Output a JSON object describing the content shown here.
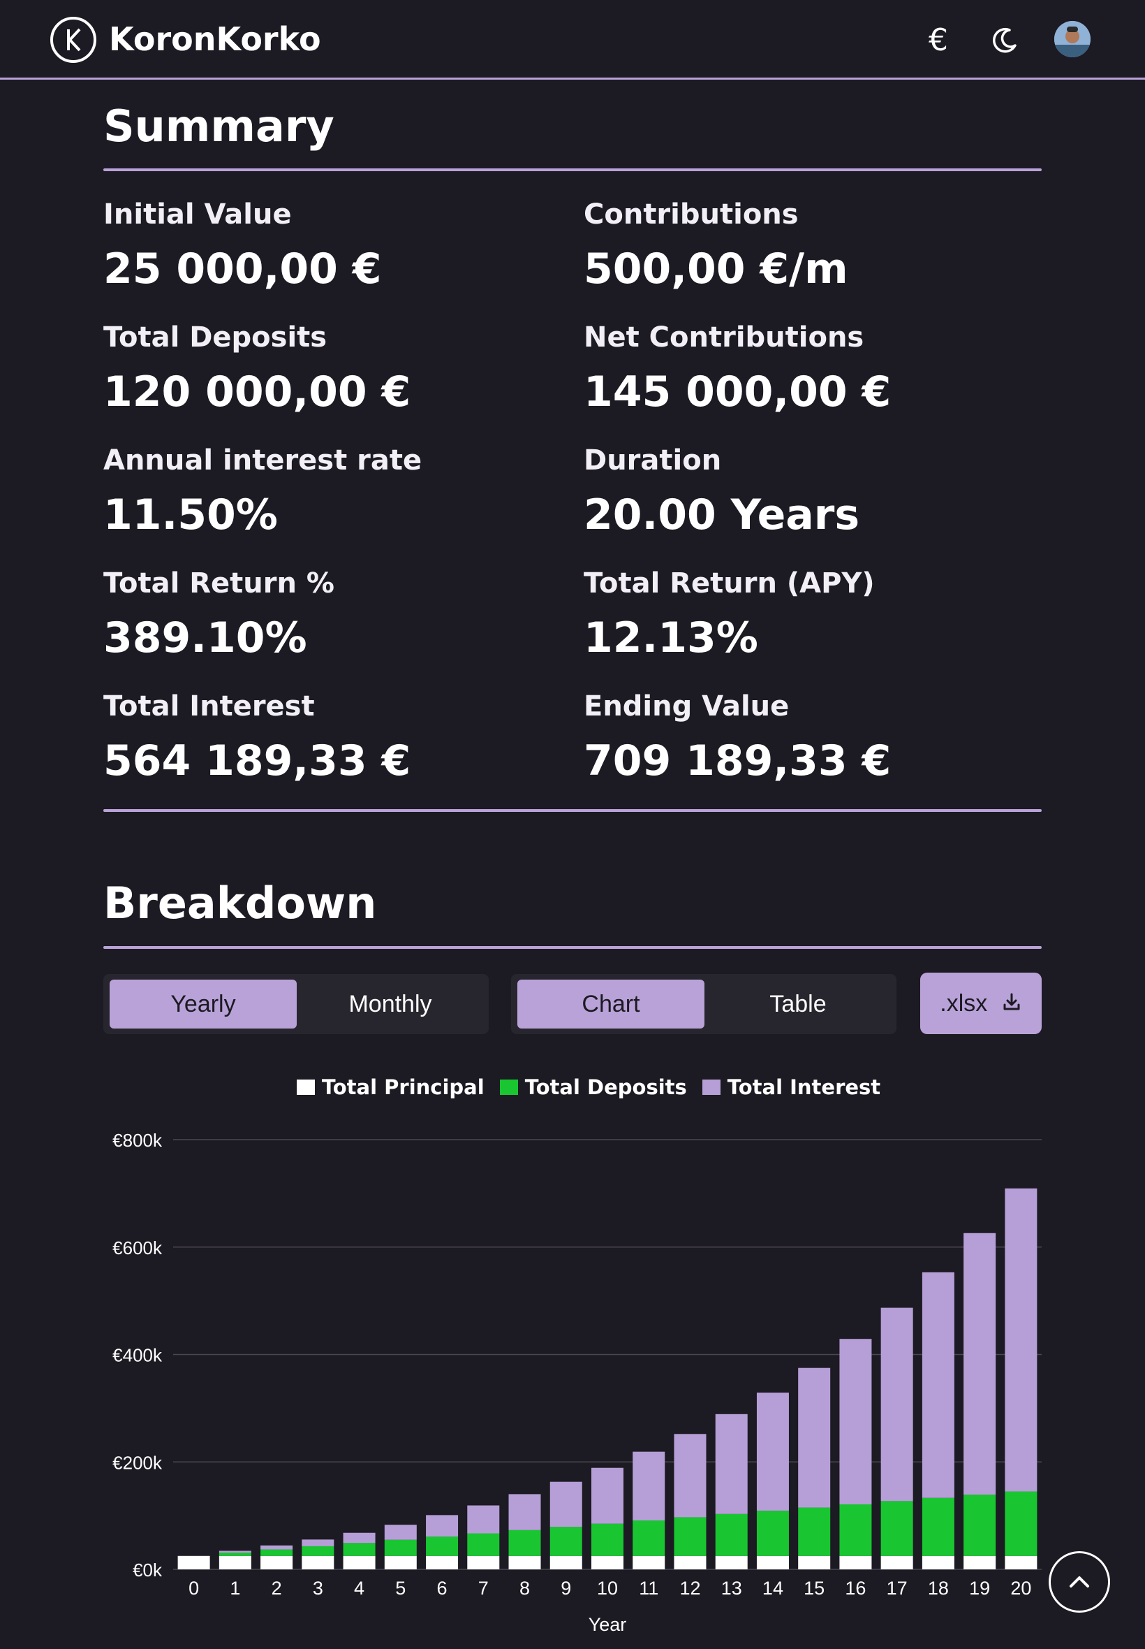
{
  "header": {
    "brand": "KoronKorko",
    "currency_icon": "€",
    "icons": [
      "logo-icon",
      "euro-icon",
      "moon-icon",
      "avatar"
    ]
  },
  "summary": {
    "title": "Summary",
    "stats": [
      {
        "label": "Initial Value",
        "value": "25 000,00 €"
      },
      {
        "label": "Contributions",
        "value": "500,00 €/m"
      },
      {
        "label": "Total Deposits",
        "value": "120 000,00 €"
      },
      {
        "label": "Net Contributions",
        "value": "145 000,00 €"
      },
      {
        "label": "Annual interest rate",
        "value": "11.50%"
      },
      {
        "label": "Duration",
        "value": "20.00 Years"
      },
      {
        "label": "Total Return %",
        "value": "389.10%"
      },
      {
        "label": "Total Return (APY)",
        "value": "12.13%"
      },
      {
        "label": "Total Interest",
        "value": "564 189,33 €"
      },
      {
        "label": "Ending Value",
        "value": "709 189,33 €"
      }
    ]
  },
  "breakdown": {
    "title": "Breakdown",
    "period_toggle": {
      "options": [
        "Yearly",
        "Monthly"
      ],
      "selected": "Yearly"
    },
    "view_toggle": {
      "options": [
        "Chart",
        "Table"
      ],
      "selected": "Chart"
    },
    "export_label": ".xlsx"
  },
  "colors": {
    "accent": "#b9a2d8",
    "background": "#1c1a22",
    "principal": "#ffffff",
    "deposits": "#19c632",
    "interest": "#b59fd6"
  },
  "chart_data": {
    "type": "bar",
    "stacked": true,
    "legend": [
      "Total Principal",
      "Total Deposits",
      "Total Interest"
    ],
    "legend_position": "top",
    "xlabel": "Year",
    "ylabel": "",
    "y_ticks": [
      "€0k",
      "€200k",
      "€400k",
      "€600k",
      "€800k"
    ],
    "ylim": [
      0,
      800000
    ],
    "grid": true,
    "categories": [
      "0",
      "1",
      "2",
      "3",
      "4",
      "5",
      "6",
      "7",
      "8",
      "9",
      "10",
      "11",
      "12",
      "13",
      "14",
      "15",
      "16",
      "17",
      "18",
      "19",
      "20"
    ],
    "series": [
      {
        "name": "Total Principal",
        "values": [
          25000,
          25000,
          25000,
          25000,
          25000,
          25000,
          25000,
          25000,
          25000,
          25000,
          25000,
          25000,
          25000,
          25000,
          25000,
          25000,
          25000,
          25000,
          25000,
          25000,
          25000
        ]
      },
      {
        "name": "Total Deposits",
        "values": [
          0,
          6000,
          12000,
          18000,
          24000,
          30000,
          36000,
          42000,
          48000,
          54000,
          60000,
          66000,
          72000,
          78000,
          84000,
          90000,
          96000,
          102000,
          108000,
          114000,
          120000
        ]
      },
      {
        "name": "Total Interest",
        "values": [
          0,
          3500,
          7500,
          12500,
          19000,
          28000,
          40000,
          52000,
          67000,
          84000,
          104000,
          128000,
          155000,
          186000,
          220000,
          260000,
          308000,
          360000,
          420000,
          487000,
          564189
        ]
      }
    ]
  }
}
